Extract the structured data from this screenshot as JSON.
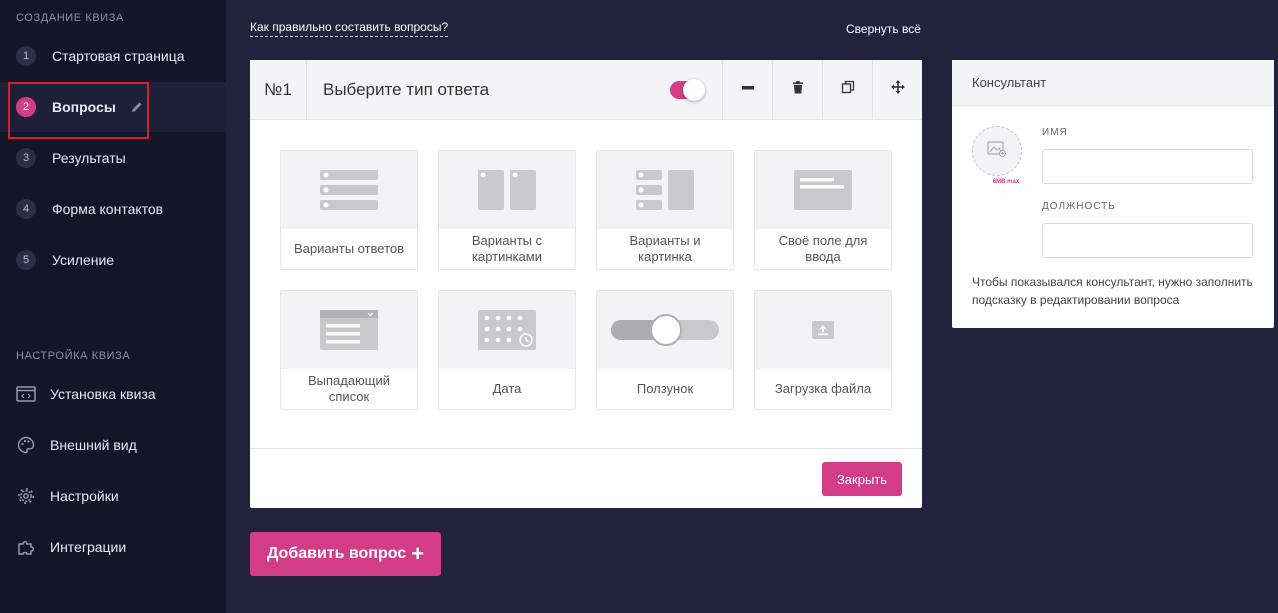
{
  "sidebar": {
    "section_create": "СОЗДАНИЕ КВИЗА",
    "steps": [
      {
        "num": "1",
        "label": "Стартовая страница"
      },
      {
        "num": "2",
        "label": "Вопросы"
      },
      {
        "num": "3",
        "label": "Результаты"
      },
      {
        "num": "4",
        "label": "Форма контактов"
      },
      {
        "num": "5",
        "label": "Усиление"
      }
    ],
    "section_settings": "НАСТРОЙКА КВИЗА",
    "settings_items": [
      {
        "label": "Установка квиза",
        "icon": "code-window-icon"
      },
      {
        "label": "Внешний вид",
        "icon": "palette-icon"
      },
      {
        "label": "Настройки",
        "icon": "gear-icon"
      },
      {
        "label": "Интеграции",
        "icon": "puzzle-icon"
      }
    ]
  },
  "top": {
    "help_link": "Как правильно составить вопросы?",
    "collapse_all": "Свернуть всё"
  },
  "question": {
    "number": "№1",
    "title": "Выберите тип ответа",
    "enabled": true,
    "answer_types": [
      "Варианты ответов",
      "Варианты с картинками",
      "Варианты и картинка",
      "Своё поле для ввода",
      "Выпадающий список",
      "Дата",
      "Ползунок",
      "Загрузка файла"
    ],
    "close_label": "Закрыть"
  },
  "add_question_label": "Добавить вопрос",
  "consultant": {
    "title": "Консультант",
    "avatar_limit": "6MB max",
    "name_label": "ИМЯ",
    "name_value": "",
    "position_label": "ДОЛЖНОСТЬ",
    "position_value": "",
    "note": "Чтобы показывался консультант, нужно заполнить подсказку в редактировании вопроса"
  },
  "colors": {
    "accent": "#d33d87",
    "sidebar_bg": "#15152a",
    "page_bg": "#22223d"
  }
}
